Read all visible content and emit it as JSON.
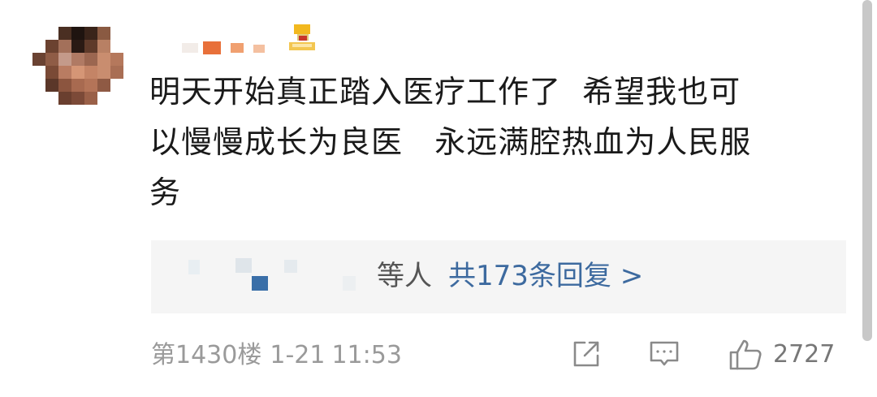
{
  "post": {
    "content_lines": [
      "明天开始真正踏入医疗工作了  希望我也可",
      "以慢慢成长为良医   永远满腔热血为人民服",
      "务"
    ],
    "reply_summary": {
      "suffix": "等人",
      "count_text": "共173条回复 >"
    },
    "floor": "第1430楼",
    "date": "1-21",
    "time": "11:53",
    "like_count": "2727"
  },
  "icons": {
    "share": "share-icon",
    "comment": "comment-icon",
    "like": "thumbs-up-icon"
  },
  "colors": {
    "link": "#3d6a9f",
    "meta": "#9a9a9a",
    "reply_bg": "#f5f5f5",
    "text": "#1a1a1a"
  }
}
